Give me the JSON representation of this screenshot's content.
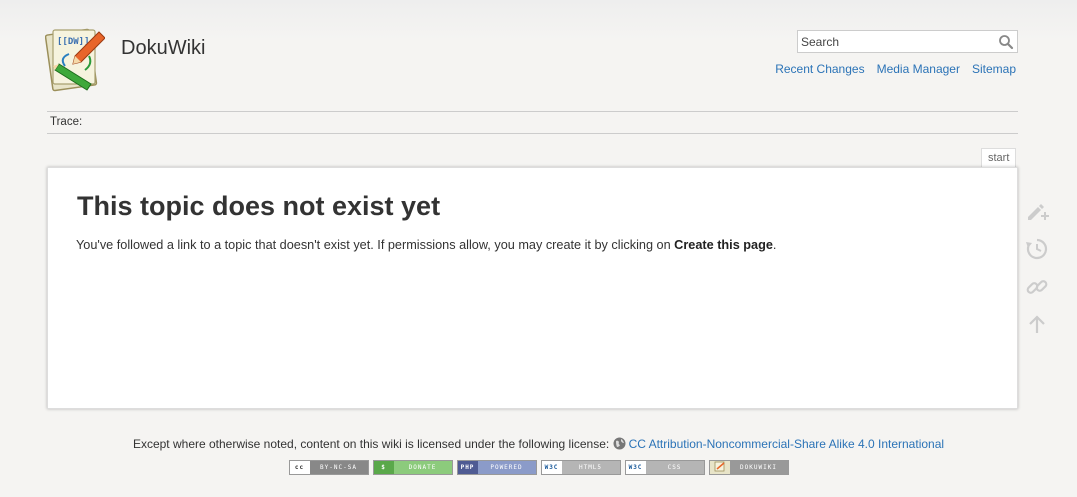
{
  "site": {
    "title": "DokuWiki",
    "logo_text": "[[DW]]"
  },
  "search": {
    "placeholder": "Search",
    "value": ""
  },
  "usertools": [
    {
      "label": "Recent Changes"
    },
    {
      "label": "Media Manager"
    },
    {
      "label": "Sitemap"
    }
  ],
  "breadcrumbs": {
    "label": "Trace:"
  },
  "page": {
    "tab_label": "start",
    "heading": "This topic does not exist yet",
    "body_text": "You've followed a link to a topic that doesn't exist yet. If permissions allow, you may create it by clicking on ",
    "body_link": "Create this page",
    "body_end": "."
  },
  "pagetools": [
    "create-page-icon",
    "old-revisions-icon",
    "backlinks-icon",
    "back-to-top-icon"
  ],
  "footer": {
    "license_text": "Except where otherwise noted, content on this wiki is licensed under the following license:",
    "license_link": "CC Attribution-Noncommercial-Share Alike 4.0 International",
    "badges": [
      {
        "left": "cc",
        "right": "BY-NC-SA"
      },
      {
        "left": "$",
        "right": "DONATE"
      },
      {
        "left": "PHP",
        "right": "POWERED"
      },
      {
        "left": "W3C",
        "right": "HTML5"
      },
      {
        "left": "W3C",
        "right": "CSS"
      },
      {
        "left": "",
        "right": "DOKUWIKI"
      }
    ]
  },
  "colors": {
    "link": "#2b73b7",
    "background": "#f5f4f2",
    "border": "#cccccc",
    "icon": "#cccccc"
  }
}
